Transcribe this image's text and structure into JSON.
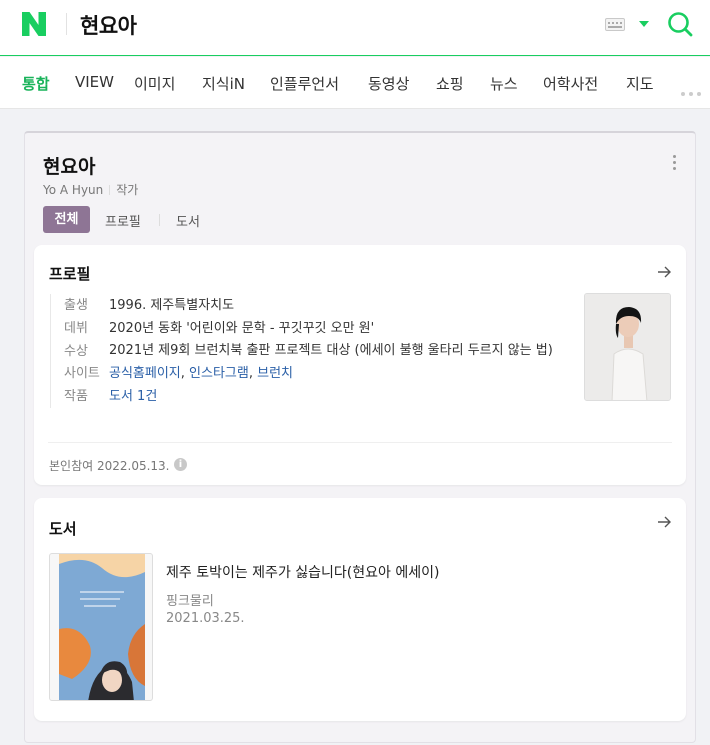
{
  "header": {
    "query": "현요아",
    "keyboard_icon": "keyboard-icon",
    "accent": "#19ce60"
  },
  "tabs": [
    {
      "label": "통합",
      "active": true
    },
    {
      "label": "VIEW"
    },
    {
      "label": "이미지"
    },
    {
      "label": "지식iN"
    },
    {
      "label": "인플루언서"
    },
    {
      "label": "동영상"
    },
    {
      "label": "쇼핑"
    },
    {
      "label": "뉴스"
    },
    {
      "label": "어학사전"
    },
    {
      "label": "지도"
    }
  ],
  "person": {
    "name": "현요아",
    "english_name": "Yo A Hyun",
    "occupation": "작가",
    "subtabs": {
      "all": "전체",
      "profile": "프로필",
      "books": "도서"
    },
    "accent": "#8e7595"
  },
  "profile": {
    "title": "프로필",
    "rows": [
      {
        "label": "출생",
        "value": "1996. 제주특별자치도"
      },
      {
        "label": "데뷔",
        "value": "2020년 동화 '어린이와 문학 - 꾸깃꾸깃 오만 원'"
      },
      {
        "label": "수상",
        "value": "2021년 제9회 브런치북 출판 프로젝트 대상 (에세이 불행 울타리 두르지 않는 법)"
      },
      {
        "label": "사이트",
        "links": [
          "공식홈페이지",
          "인스타그램",
          "브런치"
        ],
        "sep": ", "
      },
      {
        "label": "작품",
        "value": "도서 1건"
      }
    ],
    "self_reference": "본인참여 2022.05.13.",
    "info_glyph": "i"
  },
  "books": {
    "title": "도서",
    "items": [
      {
        "title": "제주 토박이는 제주가 싫습니다(현요아 에세이)",
        "publisher": "핑크물리",
        "date": "2021.03.25."
      }
    ]
  }
}
